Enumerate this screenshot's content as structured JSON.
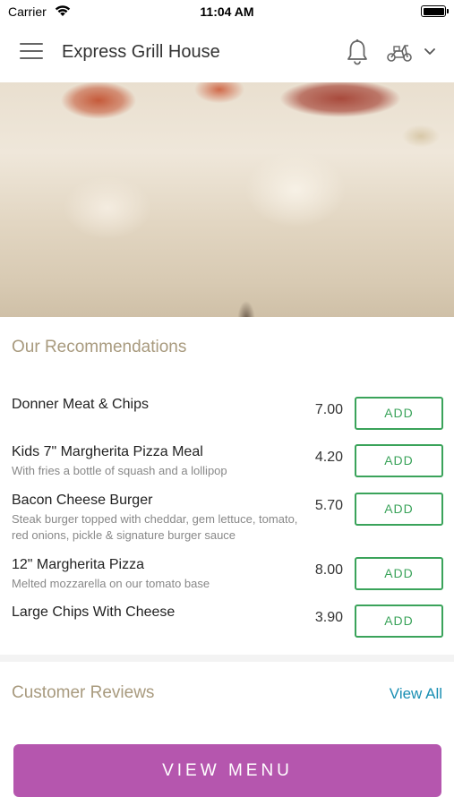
{
  "status_bar": {
    "carrier": "Carrier",
    "time": "11:04 AM"
  },
  "header": {
    "title": "Express Grill House",
    "icons": [
      "menu-icon",
      "bell-icon",
      "scooter-icon",
      "chevron-down-icon"
    ]
  },
  "hero": {
    "image": "pizza-cheese-pull"
  },
  "recommendations": {
    "title": "Our Recommendations",
    "add_label": "ADD",
    "items": [
      {
        "name": "Donner Meat & Chips",
        "description": "",
        "price": "7.00"
      },
      {
        "name": "Kids 7\" Margherita Pizza Meal",
        "description": "With fries a bottle of squash and a lollipop",
        "price": "4.20"
      },
      {
        "name": "Bacon Cheese Burger",
        "description": "Steak burger topped with cheddar, gem lettuce, tomato, red onions, pickle & signature burger sauce",
        "price": "5.70"
      },
      {
        "name": "12\" Margherita Pizza",
        "description": "Melted mozzarella on our tomato base",
        "price": "8.00"
      },
      {
        "name": "Large Chips With Cheese",
        "description": "",
        "price": "3.90"
      }
    ]
  },
  "reviews": {
    "title": "Customer Reviews",
    "view_all": "View All"
  },
  "cta": {
    "label": "VIEW MENU"
  },
  "colors": {
    "accent_purple": "#b556ae",
    "add_green": "#3aa35a",
    "section_title": "#a89a7e",
    "link_blue": "#1a8fb3"
  }
}
